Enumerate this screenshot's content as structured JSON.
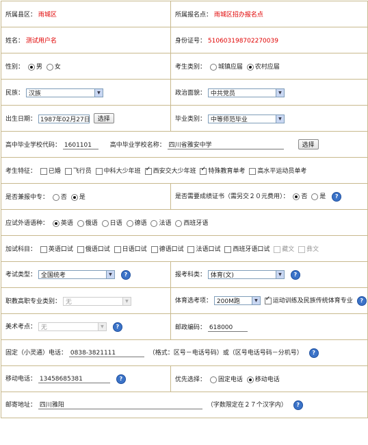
{
  "county": {
    "label": "所属县区：",
    "value": "雨城区"
  },
  "site": {
    "label": "所属报名点：",
    "value": "雨城区招办报名点"
  },
  "name": {
    "label": "姓名：",
    "value": "测试用户名"
  },
  "idcard": {
    "label": "身份证号：",
    "value": "510603198702270039"
  },
  "gender": {
    "label": "性别：",
    "options": [
      "男",
      "女"
    ],
    "selected": "男"
  },
  "examinee_type": {
    "label": "考生类别：",
    "options": [
      "城镇应届",
      "农村应届"
    ],
    "selected": "农村应届"
  },
  "ethnicity": {
    "label": "民族：",
    "value": "汉族"
  },
  "politics": {
    "label": "政治面貌：",
    "value": "中共党员"
  },
  "birth": {
    "label": "出生日期：",
    "value": "1987年02月27日",
    "button": "选择"
  },
  "grad_type": {
    "label": "毕业类别：",
    "value": "中等师范毕业"
  },
  "school": {
    "code_label": "高中毕业学校代码：",
    "code": "1601101",
    "name_label": "高中毕业学校名称：",
    "name": "四川省雅安中学",
    "button": "选择"
  },
  "features": {
    "label": "考生特征：",
    "items": [
      {
        "text": "已婚",
        "checked": false
      },
      {
        "text": "飞行员",
        "checked": false
      },
      {
        "text": "中科大少年班",
        "checked": false
      },
      {
        "text": "西安交大少年班",
        "checked": true
      },
      {
        "text": "特殊教育单考",
        "checked": true
      },
      {
        "text": "高水平运动员单考",
        "checked": false
      }
    ]
  },
  "vocational": {
    "label": "是否兼报中专：",
    "options": [
      "否",
      "是"
    ],
    "selected": "是"
  },
  "transcript": {
    "label": "是否需要成绩证书（需另交２０元费用）：",
    "options": [
      "否",
      "是"
    ],
    "selected": "否"
  },
  "language": {
    "label": "应试外语语种：",
    "options": [
      "英语",
      "俄语",
      "日语",
      "德语",
      "法语",
      "西班牙语"
    ],
    "selected": "英语"
  },
  "extra": {
    "label": "加试科目：",
    "items": [
      {
        "text": "英语口试",
        "disabled": false
      },
      {
        "text": "俄语口试",
        "disabled": false
      },
      {
        "text": "日语口试",
        "disabled": false
      },
      {
        "text": "德语口试",
        "disabled": false
      },
      {
        "text": "法语口试",
        "disabled": false
      },
      {
        "text": "西班牙语口试",
        "disabled": false
      },
      {
        "text": "藏文",
        "disabled": true
      },
      {
        "text": "彝文",
        "disabled": true
      }
    ]
  },
  "exam_type": {
    "label": "考试类型：",
    "value": "全国统考"
  },
  "subject": {
    "label": "报考科类：",
    "value": "体育(文)"
  },
  "major": {
    "label": "职教高职专业类别：",
    "value": "无"
  },
  "sport": {
    "label": "体育选考项：",
    "value": "200M跑",
    "check_text": "运动训练及民族传统体育专业",
    "checked": true
  },
  "art": {
    "label": "美术考点：",
    "value": "无"
  },
  "postcode": {
    "label": "邮政编码：",
    "value": "618000"
  },
  "phone": {
    "label": "固定（小灵通）电话：",
    "value": "0838-3821111",
    "hint": "（格式：区号－电话号码）或（区号电话号码－分机号）"
  },
  "mobile": {
    "label": "移动电话：",
    "value": "13458685381"
  },
  "preferred": {
    "label": "优先选择：",
    "options": [
      "固定电话",
      "移动电话"
    ],
    "selected": "移动电话"
  },
  "address": {
    "label": "邮寄地址：",
    "value": "四川雅阳",
    "hint": "（字数限定在２７个汉字内）"
  },
  "help_icon": "help-question-icon"
}
